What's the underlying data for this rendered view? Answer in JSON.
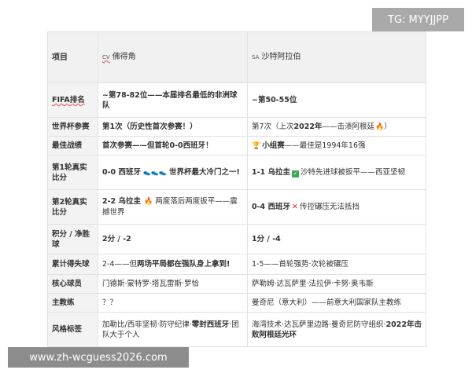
{
  "watermark": "TG: MYYJJPP",
  "site_banner": "www.zh-wcguess2026.com",
  "table": {
    "header": {
      "item": "项目",
      "team_a_code": "CV",
      "team_a_name": "佛得角",
      "team_b_code": "SA",
      "team_b_name": "沙特阿拉伯"
    },
    "rows": [
      {
        "label": "FIFA排名",
        "a": "~第78-82位——本届排名最低的非洲球队",
        "b": "~第50-55位"
      },
      {
        "label": "世界杯参赛",
        "a": "第1次（历史性首次参赛！）",
        "b_pre": "第7次（上次",
        "b_bold": "2022年",
        "b_post": "——击溃阿根廷",
        "b_icon": "fire-icon"
      },
      {
        "label": "最佳战绩",
        "a": "首次参赛——但首轮0-0西班牙！",
        "b_icon": "trophy-icon",
        "b_bold": "小组赛",
        "b_post": "——最佳是1994年16强"
      },
      {
        "label": "第1轮真实比分",
        "a_bold": "0-0 西班牙",
        "a_icons": "boot-icon",
        "a_post": "世界杯最大冷门之一!",
        "b_bold": "1-1 乌拉圭",
        "b_icon": "check-icon",
        "b_post": "沙特先进球被扳平——西亚坚韧"
      },
      {
        "label": "第2轮真实比分",
        "a_bold": "2-2 乌拉圭",
        "a_icon": "fire-icon",
        "a_post": "两度落后两度扳平——震撼世界",
        "b_bold": "0-4 西班牙",
        "b_icon": "cross-icon",
        "b_post": "传控碾压无法抵挡"
      },
      {
        "label": "积分 / 净胜球",
        "a": "2分 / -2",
        "b": "1分 / -4"
      },
      {
        "label": "累计得失球",
        "a_pre": "2-4——但",
        "a_bold": "两场平局都在强队身上拿到!",
        "b": "1-5——首轮强势·次轮被碾压"
      },
      {
        "label": "核心球员",
        "a": "门德斯·蒙特罗·塔瓦雷斯·罗恰",
        "b": "萨勒姆·达瓦萨里·法拉伊·卡努·奥韦斯"
      },
      {
        "label": "主教练",
        "a": "？？",
        "b": "曼奇尼（意大利）——前意大利国家队主教练"
      },
      {
        "label": "风格标签",
        "a_pre": "加勒比/西非坚韧·防守纪律·",
        "a_bold": "零封西班牙",
        "a_post": "·团队大于个人",
        "b_pre": "海湾技术·达瓦萨里边路·曼奇尼防守组织·",
        "b_bold": "2022年击败阿根廷光环"
      }
    ]
  }
}
